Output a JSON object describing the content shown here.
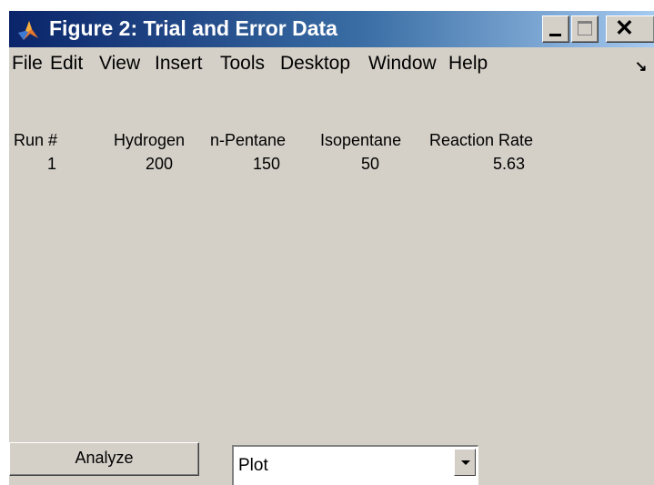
{
  "window": {
    "title": "Figure 2: Trial and Error Data",
    "icon": "matlab-icon",
    "controls": [
      "minimize-icon",
      "maximize-icon",
      "close-icon"
    ]
  },
  "menu": [
    "File",
    "Edit",
    "View",
    "Insert",
    "Tools",
    "Desktop",
    "Window",
    "Help"
  ],
  "table": {
    "headers": [
      "Run #",
      "Hydrogen",
      "n-Pentane",
      "Isopentane",
      "Reaction Rate"
    ],
    "rows": [
      [
        "1",
        "200",
        "150",
        "50",
        "5.63"
      ]
    ]
  },
  "controls": {
    "analyze_label": "Analyze",
    "plot_select_value": "Plot"
  },
  "colors": {
    "title_bar_start": "#0a246a",
    "title_bar_end": "#a6caf0",
    "window_background": "#d4d0c8"
  }
}
